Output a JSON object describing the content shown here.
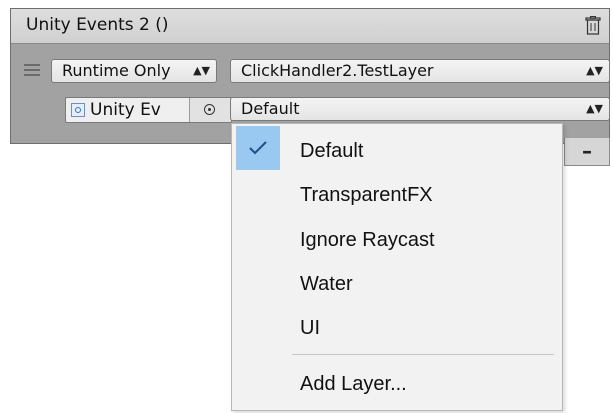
{
  "inspector": {
    "event_title": "Unity Events 2 ()",
    "runtime_mode": "Runtime Only",
    "function_name": "ClickHandler2.TestLayer",
    "target_object": "Unity Ev",
    "layer_value": "Default",
    "remove_label": "–"
  },
  "dropdown": {
    "selected": "Default",
    "items": [
      "Default",
      "TransparentFX",
      "Ignore Raycast",
      "Water",
      "UI"
    ],
    "add_layer": "Add Layer..."
  },
  "colors": {
    "selection": "#99c9f0",
    "panel": "#a2a2a2",
    "menu": "#f2f2f2"
  }
}
